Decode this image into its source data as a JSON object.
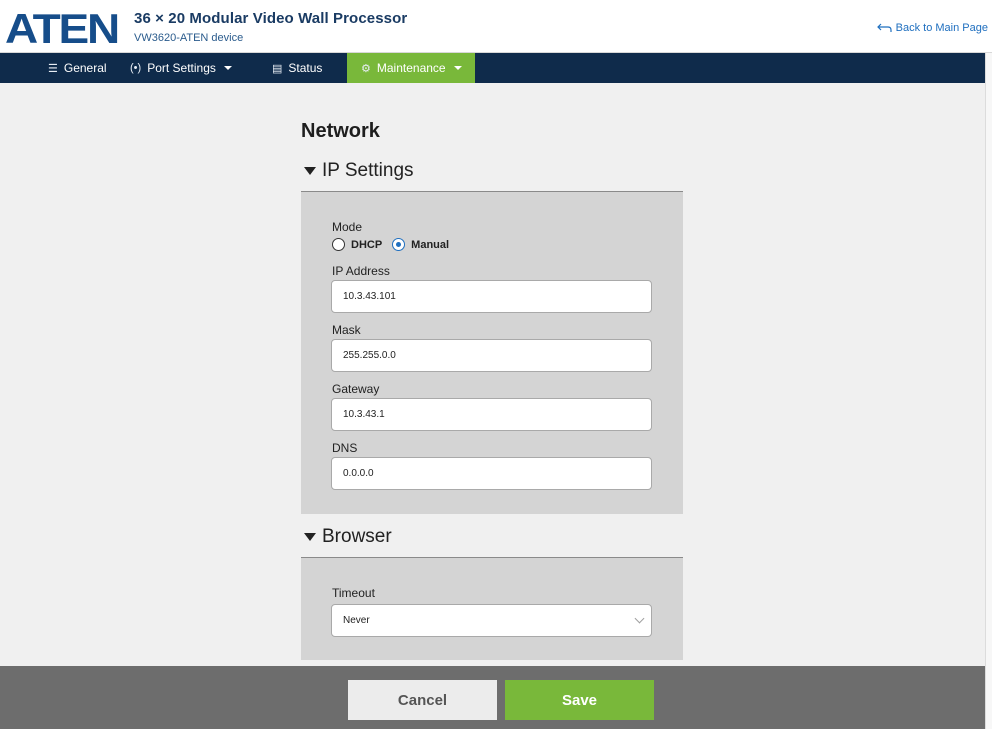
{
  "header": {
    "logo_text": "ATEN",
    "title": "36 × 20 Modular Video Wall Processor",
    "subtitle": "VW3620-ATEN device",
    "back_label": "Back to Main Page"
  },
  "nav": {
    "items": [
      {
        "label": "General",
        "icon": "list-icon"
      },
      {
        "label": "Port Settings",
        "icon": "port-icon"
      },
      {
        "label": "Status",
        "icon": "status-icon"
      },
      {
        "label": "Maintenance",
        "icon": "gear-icon",
        "active": true
      }
    ]
  },
  "page": {
    "title": "Network",
    "ip_section": {
      "heading": "IP Settings",
      "mode_label": "Mode",
      "mode_options": [
        "DHCP",
        "Manual"
      ],
      "mode_selected": "Manual",
      "ip_label": "IP Address",
      "ip_value": "10.3.43.101",
      "mask_label": "Mask",
      "mask_value": "255.255.0.0",
      "gateway_label": "Gateway",
      "gateway_value": "10.3.43.1",
      "dns_label": "DNS",
      "dns_value": "0.0.0.0"
    },
    "browser_section": {
      "heading": "Browser",
      "timeout_label": "Timeout",
      "timeout_value": "Never"
    }
  },
  "footer": {
    "cancel_label": "Cancel",
    "save_label": "Save"
  },
  "colors": {
    "navbar": "#0f2b4b",
    "accent_green": "#79b83a",
    "panel_gray": "#d4d4d4",
    "footer_gray": "#6d6d6d",
    "link_blue": "#1f6fbf"
  }
}
